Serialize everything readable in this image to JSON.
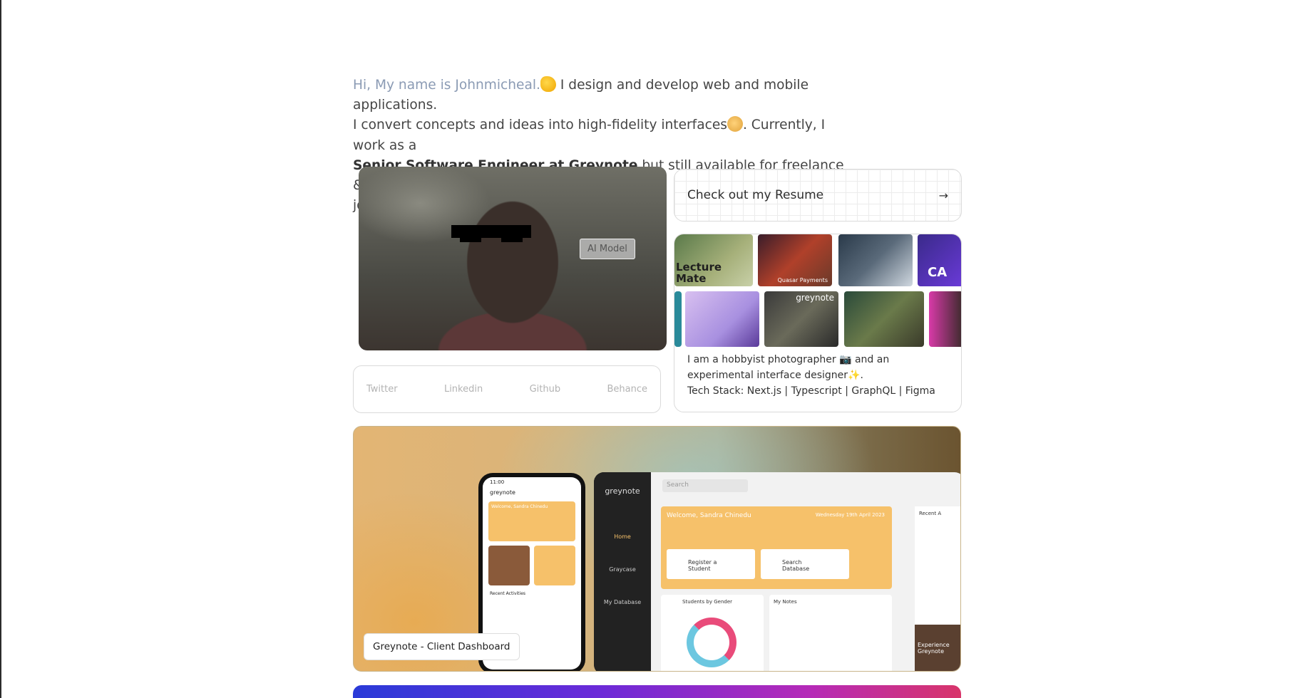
{
  "intro": {
    "greeting": "Hi, My name is Johnmicheal.",
    "line_design": " I design and develop web and mobile applications.",
    "line_convert": "I convert concepts and ideas into high-fidelity interfaces",
    "line_currently": ". Currently, I work as a",
    "role": "Senior Software Engineer at Greynote",
    "line_freelance": " but still available for freelance & contract",
    "line_jobs": "jobs",
    "emoji_wave": "waving-hand-emoji",
    "emoji_palette": "artist-palette-emoji",
    "emoji_sunrise": "sunrise-emoji"
  },
  "profile": {
    "ai_badge": "AI Model"
  },
  "social": {
    "links": [
      "Twitter",
      "Linkedin",
      "Github",
      "Behance"
    ]
  },
  "resume": {
    "label": "Check out my Resume",
    "arrow": "→"
  },
  "gallery": {
    "thumb_lecture": "Lecture Mate",
    "thumb_quasar": "Quasar Payments",
    "thumb_greynote": "greynote",
    "thumb_ca": "CA",
    "text_photographer": "I am a hobbyist photographer 📷 and an experimental interface designer✨.",
    "text_stack": "Tech Stack: Next.js | Typescript | GraphQL | Figma"
  },
  "project": {
    "label": "Greynote - Client Dashboard",
    "phone_brand": "greynote",
    "phone_time": "11:00",
    "phone_welcome": "Welcome, Sandra Chinedu",
    "phone_recent": "Recent Activities",
    "tablet_brand": "greynote",
    "tablet_search": "Search",
    "tablet_welcome": "Welcome, Sandra Chinedu",
    "tablet_date": "Wednesday 19th April 2023",
    "tablet_register": "Register a Student",
    "tablet_search_db": "Search Database",
    "tablet_students_gender": "Students by Gender",
    "tablet_notes": "My Notes",
    "tablet_recent": "Recent A",
    "side_home": "Home",
    "side_graycase": "Graycase",
    "side_db": "My Database",
    "tablet_experience": "Experience Greynote"
  },
  "colors": {
    "greeting": "#8b9bb4",
    "greynote_accent": "#f6c16a"
  }
}
